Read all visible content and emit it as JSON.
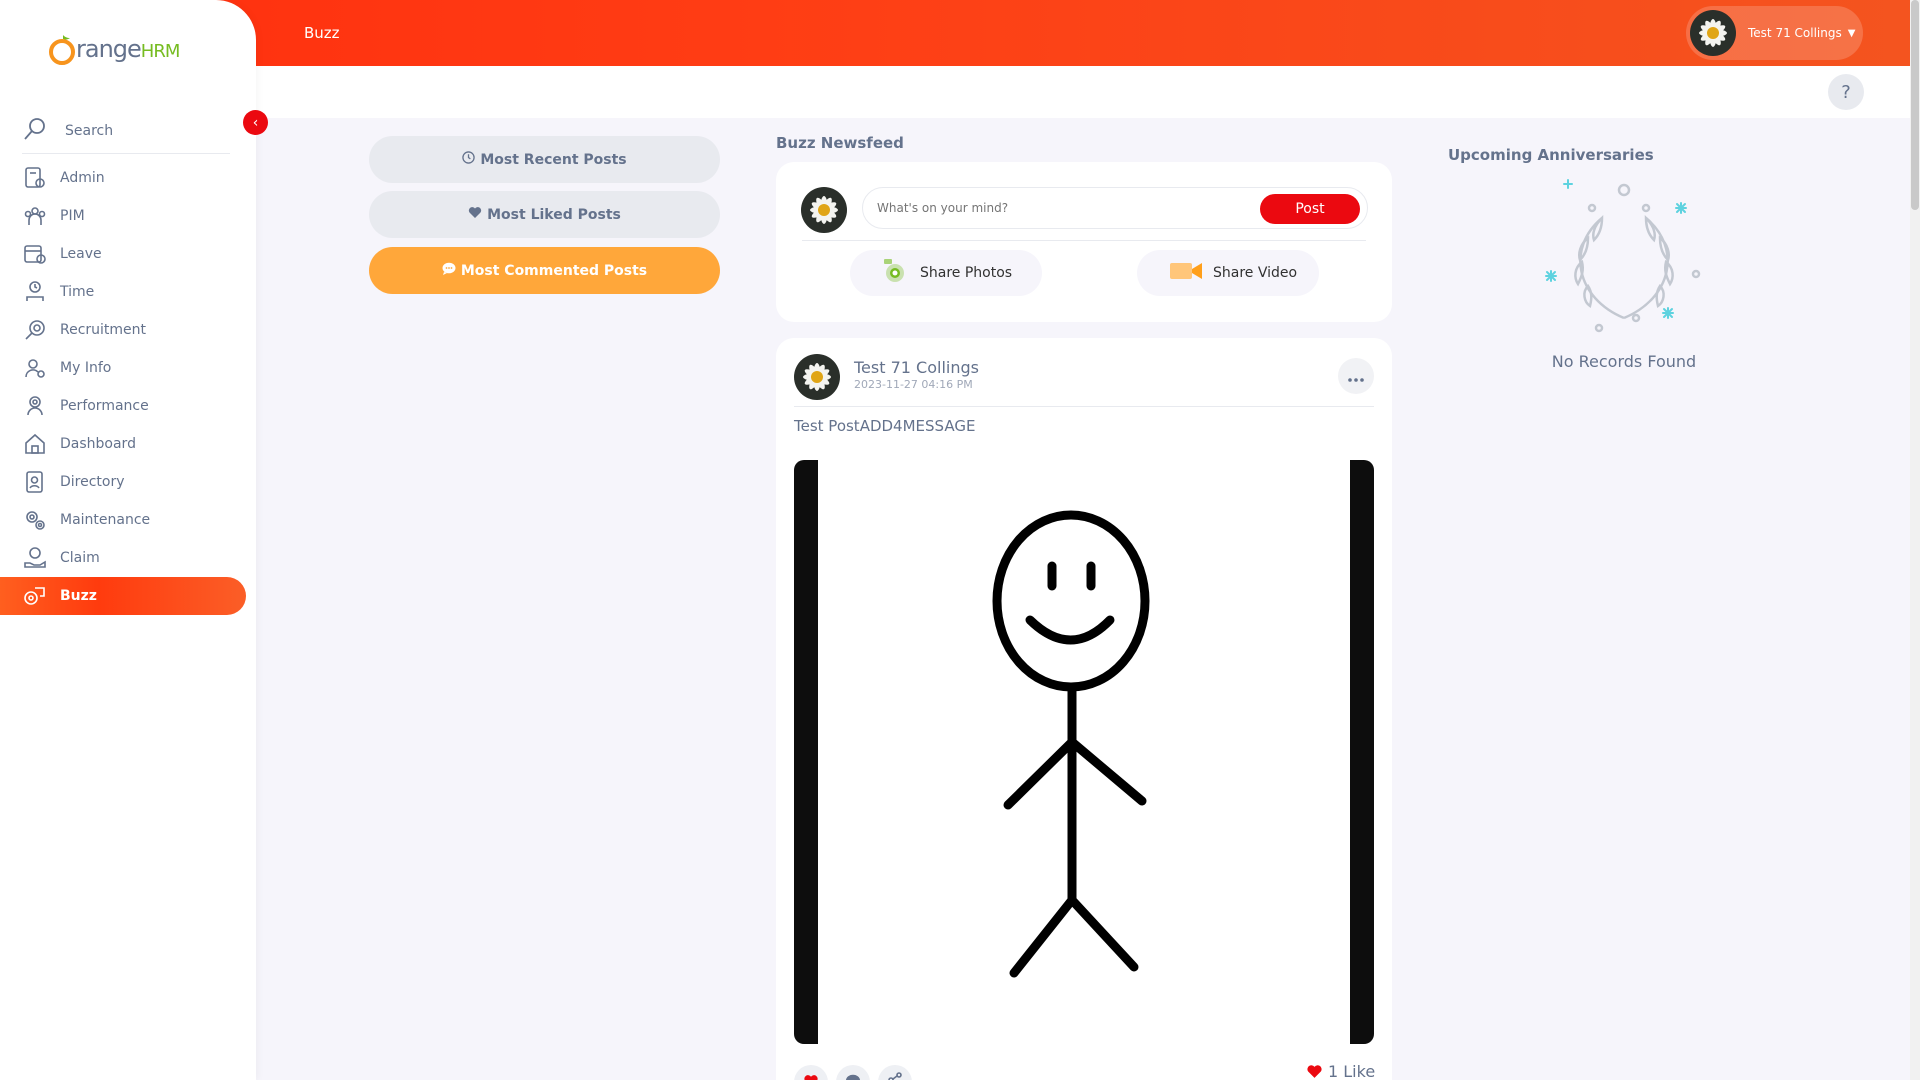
{
  "brand": {
    "name_main": "range",
    "name_suffix": "HRM",
    "initial": "O"
  },
  "topbar": {
    "title": "Buzz",
    "help_label": "?"
  },
  "user": {
    "name": "Test 71 Collings",
    "caret": "▼"
  },
  "sidebar": {
    "collapse_label": "‹",
    "search_label": "Search",
    "items": [
      {
        "label": "Admin",
        "icon": "admin-icon"
      },
      {
        "label": "PIM",
        "icon": "pim-icon"
      },
      {
        "label": "Leave",
        "icon": "leave-icon"
      },
      {
        "label": "Time",
        "icon": "time-icon"
      },
      {
        "label": "Recruitment",
        "icon": "recruitment-icon"
      },
      {
        "label": "My Info",
        "icon": "my-info-icon"
      },
      {
        "label": "Performance",
        "icon": "performance-icon"
      },
      {
        "label": "Dashboard",
        "icon": "dashboard-icon"
      },
      {
        "label": "Directory",
        "icon": "directory-icon"
      },
      {
        "label": "Maintenance",
        "icon": "maintenance-icon"
      },
      {
        "label": "Claim",
        "icon": "claim-icon"
      },
      {
        "label": "Buzz",
        "icon": "buzz-icon",
        "active": true
      }
    ]
  },
  "filters": {
    "most_recent": "Most Recent Posts",
    "most_liked": "Most Liked Posts",
    "most_commented": "Most Commented Posts",
    "active": "most_commented"
  },
  "newsfeed": {
    "title": "Buzz Newsfeed",
    "composer": {
      "placeholder": "What's on your mind?",
      "post_label": "Post",
      "share_photos_label": "Share Photos",
      "share_video_label": "Share Video"
    },
    "posts": [
      {
        "author": "Test 71 Collings",
        "date": "2023-11-27 04:16 PM",
        "text": "Test PostADD4MESSAGE",
        "likes_label": "1 Like"
      }
    ]
  },
  "anniversaries": {
    "title": "Upcoming Anniversaries",
    "empty_text": "No Records Found"
  },
  "colors": {
    "accent": "#ff3d14",
    "danger": "#eb0910",
    "active_filter": "#ffa73a",
    "text": "#64728c",
    "brand_green": "#76bc21"
  }
}
